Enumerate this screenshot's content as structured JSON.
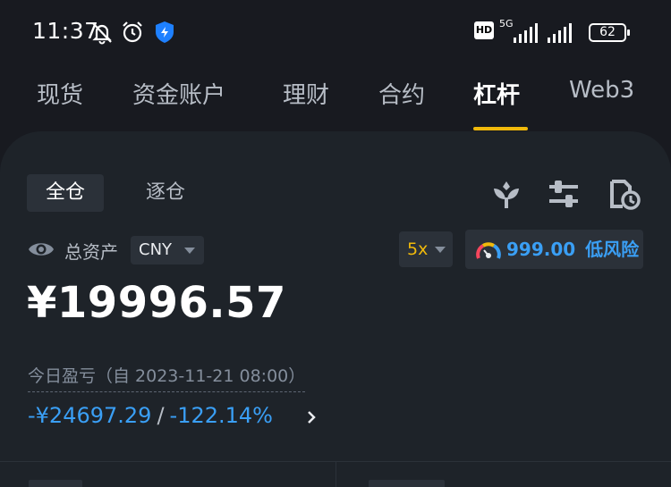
{
  "status_bar": {
    "time": "11:37",
    "network": "5G",
    "hd": "HD",
    "battery": "62",
    "icons": [
      "bell-muted-icon",
      "alarm-icon",
      "shield-icon",
      "signal-icon",
      "battery-icon"
    ]
  },
  "tabs": [
    {
      "label": "现货"
    },
    {
      "label": "资金账户"
    },
    {
      "label": "理财"
    },
    {
      "label": "合约"
    },
    {
      "label": "杠杆",
      "active": true
    },
    {
      "label": "Web3"
    }
  ],
  "account": {
    "modes": [
      {
        "label": "全仓",
        "active": true
      },
      {
        "label": "逐仓"
      }
    ],
    "tool_icons": [
      "earn-icon",
      "settings-sliders-icon",
      "history-icon"
    ],
    "assets_label": "总资产",
    "currency": "CNY",
    "leverage": "5x",
    "risk_value": "999.00",
    "risk_label": "低风险",
    "total": "¥19996.57",
    "pnl_label": "今日盈亏（自 2023-11-21 08:00）",
    "pnl_amount": "-¥24697.29",
    "pnl_separator": "/",
    "pnl_percent": "-122.14%"
  },
  "colors": {
    "background": "#181a20",
    "card": "#1e2329",
    "accent": "#f0b90b",
    "loss_blue": "#3a9ff5"
  }
}
